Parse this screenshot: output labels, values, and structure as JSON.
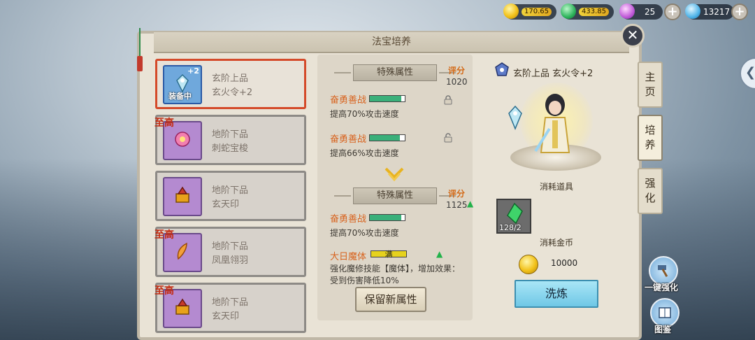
{
  "currency": {
    "gold": "170.65",
    "jade": "433.85",
    "orb": "25",
    "diamond": "13217"
  },
  "window": {
    "title": "法宝培养",
    "close": "✕"
  },
  "side_tabs": [
    {
      "label": "主\n页",
      "active": false
    },
    {
      "label": "培\n养",
      "active": true
    },
    {
      "label": "强\n化",
      "active": false
    }
  ],
  "items": [
    {
      "name1": "玄阶上品",
      "name2": "玄火令+2",
      "plus": "+2",
      "equipped": "装备中",
      "tag": "",
      "selected": true
    },
    {
      "name1": "地阶下品",
      "name2": "刺蛇宝梭",
      "plus": "",
      "equipped": "",
      "tag": "至高",
      "selected": false
    },
    {
      "name1": "地阶下品",
      "name2": "玄天印",
      "plus": "",
      "equipped": "",
      "tag": "",
      "selected": false
    },
    {
      "name1": "地阶下品",
      "name2": "凤凰翎羽",
      "plus": "",
      "equipped": "",
      "tag": "至高",
      "selected": false
    },
    {
      "name1": "地阶下品",
      "name2": "玄天印",
      "plus": "",
      "equipped": "",
      "tag": "至高",
      "selected": false
    }
  ],
  "current": {
    "ribbon": "特殊属性",
    "score_label": "评分",
    "score": "1020",
    "attrs": [
      {
        "name": "奋勇善战",
        "fill": 0.9,
        "color": "#3ab07a",
        "desc": "提高70%攻击速度",
        "locked": true
      },
      {
        "name": "奋勇善战",
        "fill": 0.85,
        "color": "#3ab07a",
        "desc": "提高66%攻击速度",
        "locked": false
      }
    ]
  },
  "new": {
    "ribbon": "特殊属性",
    "score_label": "评分",
    "score": "1125",
    "attrs": [
      {
        "name": "奋勇善战",
        "fill": 0.9,
        "color": "#3ab07a",
        "desc": "提高70%攻击速度",
        "text": ""
      },
      {
        "name": "大日魔体",
        "fill": 1.0,
        "color": "#e6d21e",
        "desc": "强化魔修技能【魔体】，增加效果：受到伤害降低10%",
        "text": "满"
      }
    ],
    "keep_button": "保留新属性"
  },
  "detail": {
    "hero_name": "玄阶上品 玄火令+2",
    "consume_item_label": "消耗道具",
    "material_count": "128/2",
    "consume_gold_label": "消耗金币",
    "gold_cost": "10000",
    "wash_button": "洗炼"
  },
  "floating": {
    "one_key_label": "一键强化",
    "book_label": "图鉴"
  },
  "colors": {
    "select_border": "#d44a2a",
    "score_orange": "#d36a18",
    "attr_orange": "#d8631e",
    "wash_blue": "#6fc7e6"
  }
}
